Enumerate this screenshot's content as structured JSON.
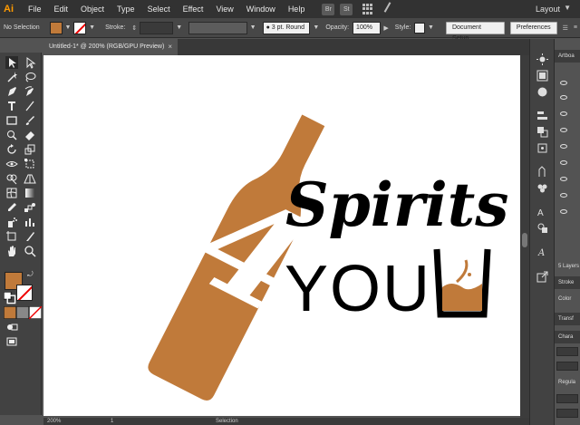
{
  "app": {
    "logo": "Ai"
  },
  "menu": [
    "File",
    "Edit",
    "Object",
    "Type",
    "Select",
    "Effect",
    "View",
    "Window",
    "Help"
  ],
  "menu_badges": [
    "Br",
    "St"
  ],
  "workspace": {
    "label": "Layout"
  },
  "control_bar": {
    "selection_label": "No Selection",
    "fill_color": "#c07a3a",
    "stroke_label": "Stroke:",
    "brush_value": "3 pt. Round",
    "opacity_label": "Opacity:",
    "opacity_value": "100%",
    "style_label": "Style:",
    "document_setup": "Document Setup",
    "preferences": "Preferences"
  },
  "document_tab": {
    "title": "Untitled-1* @ 200% (RGB/GPU Preview)",
    "close": "×"
  },
  "artwork": {
    "brand_color": "#c07a3a",
    "number": "4",
    "word1": "Spirits",
    "word2": "YOU"
  },
  "status_bar": {
    "zoom": "200%",
    "artboard": "1",
    "tool": "Selection"
  },
  "right_panel": {
    "artboards_tab": "Artboa",
    "layers_count": "5 Layers",
    "stroke_tab": "Stroke",
    "color_tab": "Color",
    "transform_tab": "Transf",
    "character_tab": "Chara",
    "font_style": "Regula"
  },
  "colors": {
    "fill": "#c07a3a",
    "ui_dark": "#323232",
    "ui_mid": "#474747",
    "canvas": "#535353"
  }
}
